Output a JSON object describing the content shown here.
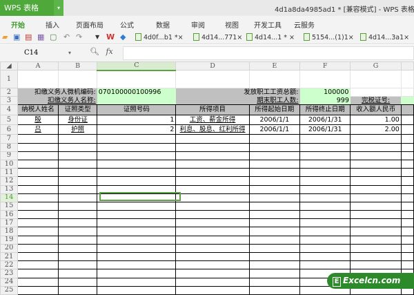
{
  "app": {
    "name": "WPS 表格",
    "window_title": "4d1a8da4985ad1 * [兼容模式] - WPS 表格"
  },
  "ribbon_tabs": [
    "开始",
    "插入",
    "页面布局",
    "公式",
    "数据",
    "审阅",
    "视图",
    "开发工具",
    "云服务"
  ],
  "doc_tabs": [
    "4d0f...b1 *×",
    "4d14...771×",
    "4d14...1 * ×",
    "5154...(1)1×",
    "4d14...3a1×"
  ],
  "formula_bar": {
    "name_box": "C14",
    "fx": "fx",
    "value": ""
  },
  "columns": [
    "A",
    "B",
    "C",
    "D",
    "E",
    "F",
    "G"
  ],
  "selected_column": "C",
  "selected_row": 14,
  "cells": {
    "A2": "扣缴义务人微机编码:",
    "C2": "070100000100996",
    "E2": "发放职工工资总额:",
    "F2": "100000",
    "A3": "扣缴义务人名称:",
    "E3": "期末职工人数:",
    "F3": "999",
    "G3": "完税证号:",
    "headers": [
      "纳税人姓名",
      "证照类型",
      "证照号码",
      "所得项目",
      "所得起始日期",
      "所得终止日期",
      "收入额人民币"
    ],
    "rows": [
      [
        "殷",
        "身份证",
        "1",
        "工资、薪金所得",
        "2006/1/1",
        "2006/1/31",
        "1.00"
      ],
      [
        "吕",
        "护照",
        "2",
        "利息、股息、红利所得",
        "2006/1/1",
        "2006/1/31",
        "2.00"
      ]
    ]
  },
  "watermark": "Excelcn.com",
  "colors": {
    "accent": "#4ea83a",
    "gray_fill": "#c0c0c0",
    "green_fill": "#ccffcc"
  }
}
